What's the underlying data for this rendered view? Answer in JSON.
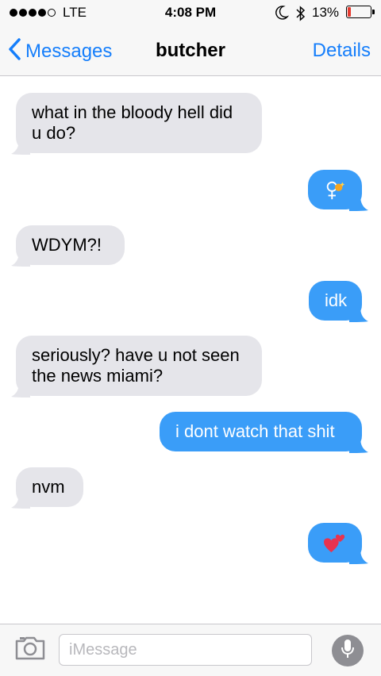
{
  "status_bar": {
    "carrier": "LTE",
    "time": "4:08 PM",
    "battery_percent": "13%",
    "battery_level": 0.13,
    "signal_bars_filled": 4,
    "signal_bars_total": 5,
    "icons": [
      "moon-icon",
      "bluetooth-icon",
      "battery-icon"
    ]
  },
  "nav": {
    "back_label": "Messages",
    "title": "butcher",
    "details_label": "Details"
  },
  "messages": [
    {
      "direction": "incoming",
      "text": "what in the bloody hell did u do?"
    },
    {
      "direction": "outgoing",
      "emoji": "female-sign-and-sparkle-emoji"
    },
    {
      "direction": "incoming",
      "text": "WDYM?!"
    },
    {
      "direction": "outgoing",
      "text": "idk"
    },
    {
      "direction": "incoming",
      "text": "seriously? have u not seen the news miami?"
    },
    {
      "direction": "outgoing",
      "text": "i dont watch that shit"
    },
    {
      "direction": "incoming",
      "text": "nvm"
    },
    {
      "direction": "outgoing",
      "emoji": "two-hearts-emoji"
    }
  ],
  "composer": {
    "placeholder": "iMessage",
    "value": ""
  },
  "colors": {
    "accent": "#157efb",
    "outgoing_bubble": "#3a9df8",
    "incoming_bubble": "#e5e5ea",
    "battery_low": "#e53a2f"
  }
}
